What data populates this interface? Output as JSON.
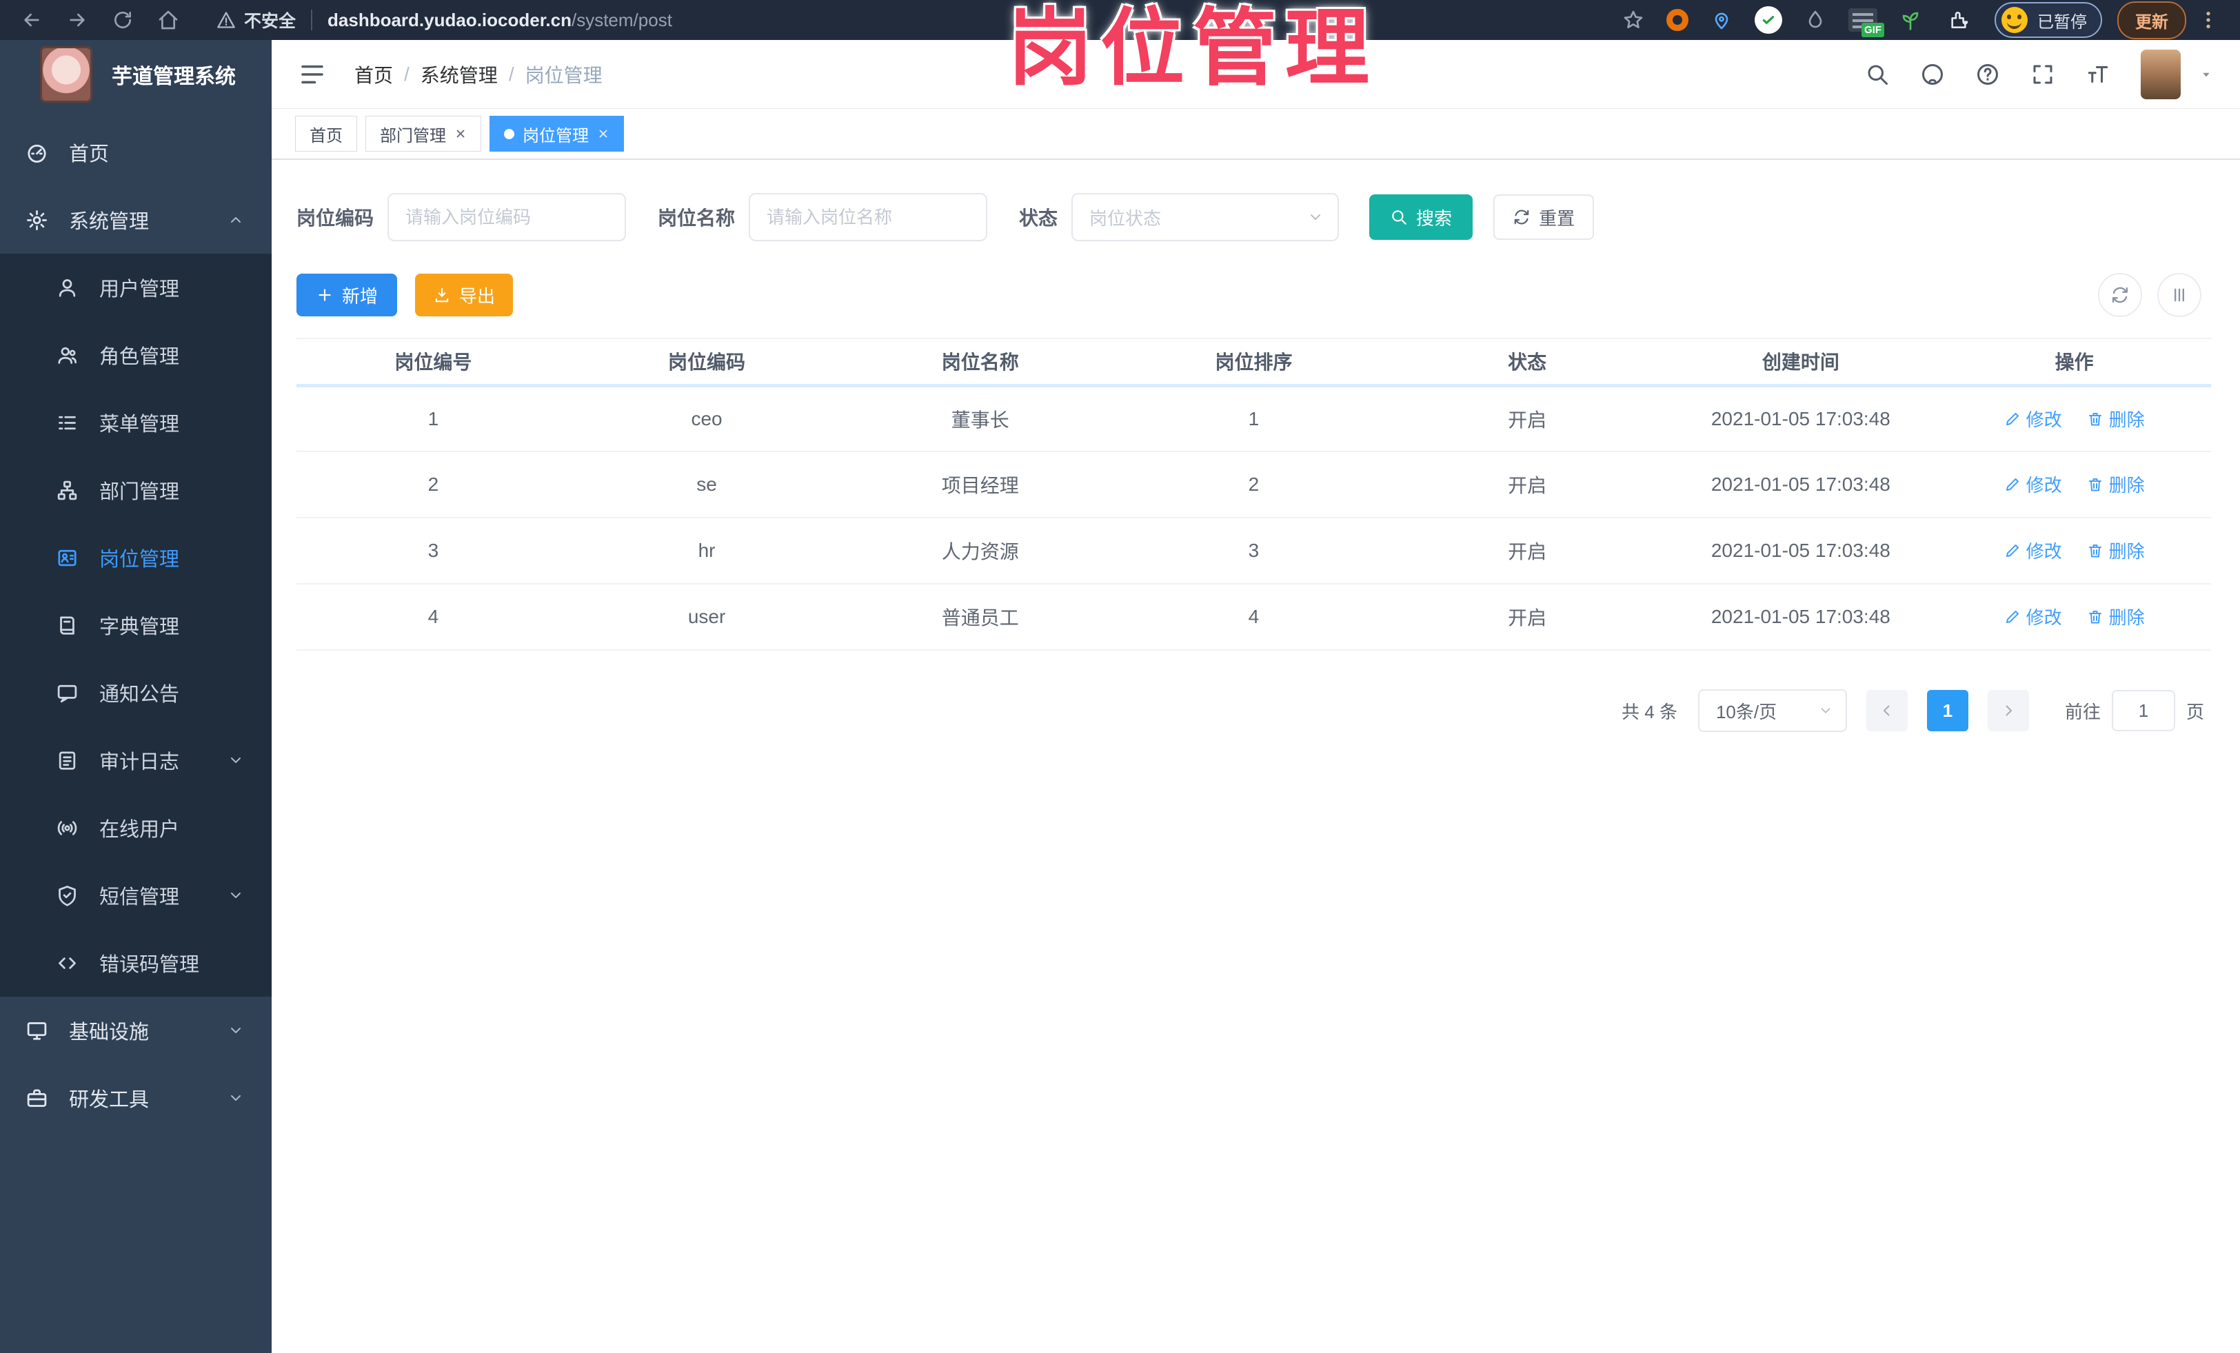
{
  "browser": {
    "security_label": "不安全",
    "url_host": "dashboard.yudao.iocoder.cn",
    "url_path": "/system/post",
    "extensions": {
      "gif_label": "GIF",
      "paused_label": "已暂停",
      "update_label": "更新"
    }
  },
  "overlay_title": "岗位管理",
  "sidebar": {
    "app_title": "芋道管理系统",
    "items": [
      {
        "key": "home",
        "label": "首页",
        "icon": "dashboard-icon",
        "level": 1
      },
      {
        "key": "system",
        "label": "系统管理",
        "icon": "gear-icon",
        "level": 1,
        "arrow": "up"
      },
      {
        "key": "user",
        "label": "用户管理",
        "icon": "user-icon",
        "level": 2,
        "submenu": true
      },
      {
        "key": "role",
        "label": "角色管理",
        "icon": "role-icon",
        "level": 2,
        "submenu": true
      },
      {
        "key": "menu",
        "label": "菜单管理",
        "icon": "menu-tree-icon",
        "level": 2,
        "submenu": true
      },
      {
        "key": "dept",
        "label": "部门管理",
        "icon": "org-icon",
        "level": 2,
        "submenu": true
      },
      {
        "key": "post",
        "label": "岗位管理",
        "icon": "id-card-icon",
        "level": 2,
        "submenu": true,
        "active": true
      },
      {
        "key": "dict",
        "label": "字典管理",
        "icon": "dict-icon",
        "level": 2,
        "submenu": true
      },
      {
        "key": "notice",
        "label": "通知公告",
        "icon": "message-icon",
        "level": 2,
        "submenu": true
      },
      {
        "key": "audit-log",
        "label": "审计日志",
        "icon": "log-icon",
        "level": 2,
        "submenu": true,
        "arrow": "down"
      },
      {
        "key": "online-user",
        "label": "在线用户",
        "icon": "broadcast-icon",
        "level": 2,
        "submenu": true
      },
      {
        "key": "sms",
        "label": "短信管理",
        "icon": "shield-icon",
        "level": 2,
        "submenu": true,
        "arrow": "down"
      },
      {
        "key": "error-code",
        "label": "错误码管理",
        "icon": "code-icon",
        "level": 2,
        "submenu": true
      },
      {
        "key": "infra",
        "label": "基础设施",
        "icon": "monitor-icon",
        "level": 1,
        "arrow": "down"
      },
      {
        "key": "dev-tools",
        "label": "研发工具",
        "icon": "toolbox-icon",
        "level": 1,
        "arrow": "down"
      }
    ]
  },
  "header": {
    "breadcrumb": [
      "首页",
      "系统管理",
      "岗位管理"
    ],
    "separator": "/"
  },
  "tabs": [
    {
      "key": "home",
      "label": "首页",
      "active": false,
      "closable": false
    },
    {
      "key": "dept",
      "label": "部门管理",
      "active": false,
      "closable": true
    },
    {
      "key": "post",
      "label": "岗位管理",
      "active": true,
      "closable": true
    }
  ],
  "filters": {
    "post_code_label": "岗位编码",
    "post_code_placeholder": "请输入岗位编码",
    "post_name_label": "岗位名称",
    "post_name_placeholder": "请输入岗位名称",
    "status_label": "状态",
    "status_placeholder": "岗位状态",
    "search_label": "搜索",
    "reset_label": "重置"
  },
  "toolbar": {
    "add_label": "新增",
    "export_label": "导出"
  },
  "table": {
    "headers": [
      "岗位编号",
      "岗位编码",
      "岗位名称",
      "岗位排序",
      "状态",
      "创建时间",
      "操作"
    ],
    "edit_label": "修改",
    "delete_label": "删除",
    "rows": [
      {
        "id": "1",
        "code": "ceo",
        "name": "董事长",
        "sort": "1",
        "status": "开启",
        "created_at": "2021-01-05 17:03:48"
      },
      {
        "id": "2",
        "code": "se",
        "name": "项目经理",
        "sort": "2",
        "status": "开启",
        "created_at": "2021-01-05 17:03:48"
      },
      {
        "id": "3",
        "code": "hr",
        "name": "人力资源",
        "sort": "3",
        "status": "开启",
        "created_at": "2021-01-05 17:03:48"
      },
      {
        "id": "4",
        "code": "user",
        "name": "普通员工",
        "sort": "4",
        "status": "开启",
        "created_at": "2021-01-05 17:03:48"
      }
    ]
  },
  "pagination": {
    "total_text": "共 4 条",
    "page_size": "10条/页",
    "current_page": "1",
    "goto_prefix": "前往",
    "goto_value": "1",
    "goto_suffix": "页"
  },
  "colors": {
    "accent_blue": "#409eff",
    "add_blue": "#2d8cf0",
    "search_teal": "#16b3a4",
    "export_orange": "#f9a218",
    "overlay_pink": "#f2405e",
    "sidebar_bg": "#304156",
    "submenu_bg": "#1f2d3d",
    "chrome_bg": "#212b3b"
  }
}
